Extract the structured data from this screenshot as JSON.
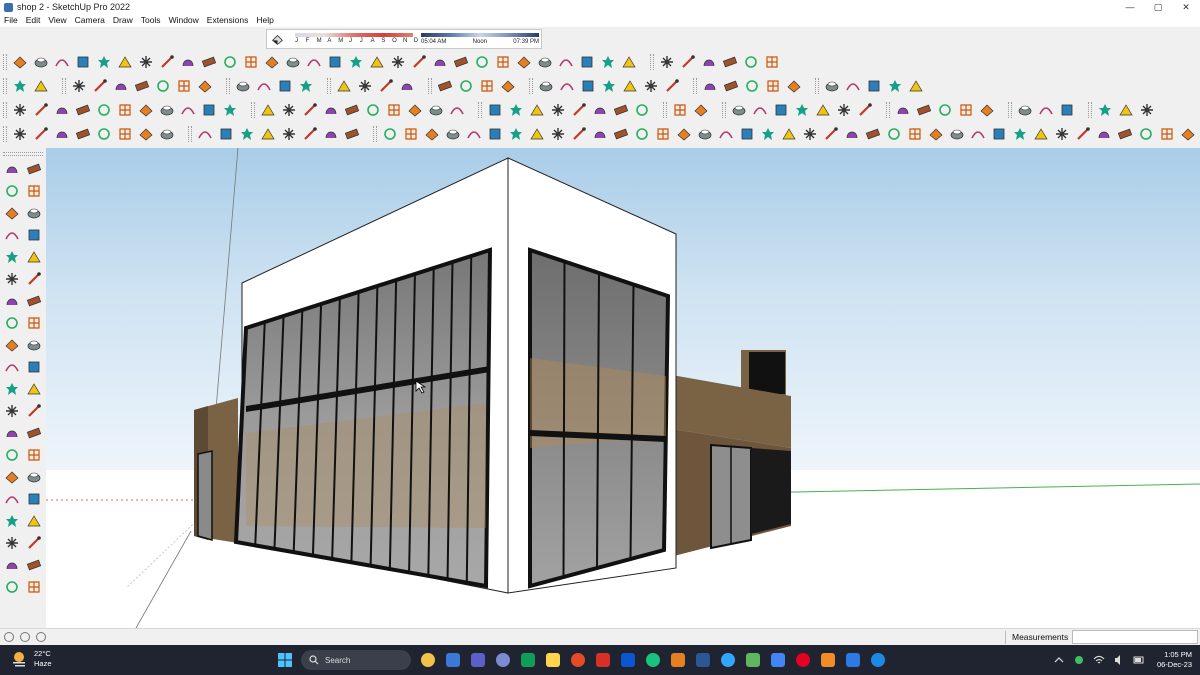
{
  "window": {
    "title": "shop 2 - SketchUp Pro 2022",
    "minimize": "—",
    "maximize": "▢",
    "close": "✕"
  },
  "menu": {
    "items": [
      "File",
      "Edit",
      "View",
      "Camera",
      "Draw",
      "Tools",
      "Window",
      "Extensions",
      "Help"
    ]
  },
  "shadows": {
    "months": [
      "J",
      "F",
      "M",
      "A",
      "M",
      "J",
      "J",
      "A",
      "S",
      "O",
      "N",
      "D"
    ],
    "time_start": "05:04 AM",
    "time_mid": "Noon",
    "time_end": "07:39 PM"
  },
  "colors": {
    "sky_top": "#a9cde8",
    "ground": "#ffffff",
    "wall_white": "#ffffff",
    "wood": "#7a6244",
    "glass": "#9a9a9a",
    "frame": "#111111",
    "taskbar": "#1f2430"
  },
  "statusbar": {
    "measurements_label": "Measurements"
  },
  "taskbar": {
    "weather_temp": "22°C",
    "weather_desc": "Haze",
    "search_placeholder": "Search",
    "clock_time": "1:05 PM",
    "clock_date": "06-Dec-23"
  }
}
